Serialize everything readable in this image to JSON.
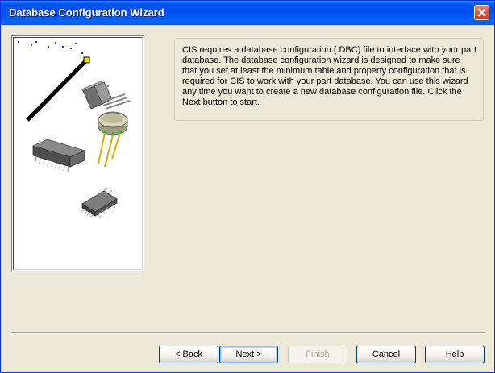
{
  "window": {
    "title": "Database Configuration Wizard"
  },
  "description": "CIS requires a database configuration (.DBC) file to interface with your part database. The database configuration wizard is designed to make sure that you set at least the minimum table and property configuration that is required for CIS to work with your part database. You can use this wizard any time you want to create a new database configuration file. Click the Next button to start.",
  "buttons": {
    "back": "< Back",
    "next": "Next >",
    "finish": "Finish",
    "cancel": "Cancel",
    "help": "Help"
  },
  "icons": {
    "close": "close-icon",
    "illustration": "electronic-components-illustration"
  },
  "colors": {
    "titlebar": "#0054E3",
    "face": "#ECE9D8",
    "close": "#C9381E"
  }
}
